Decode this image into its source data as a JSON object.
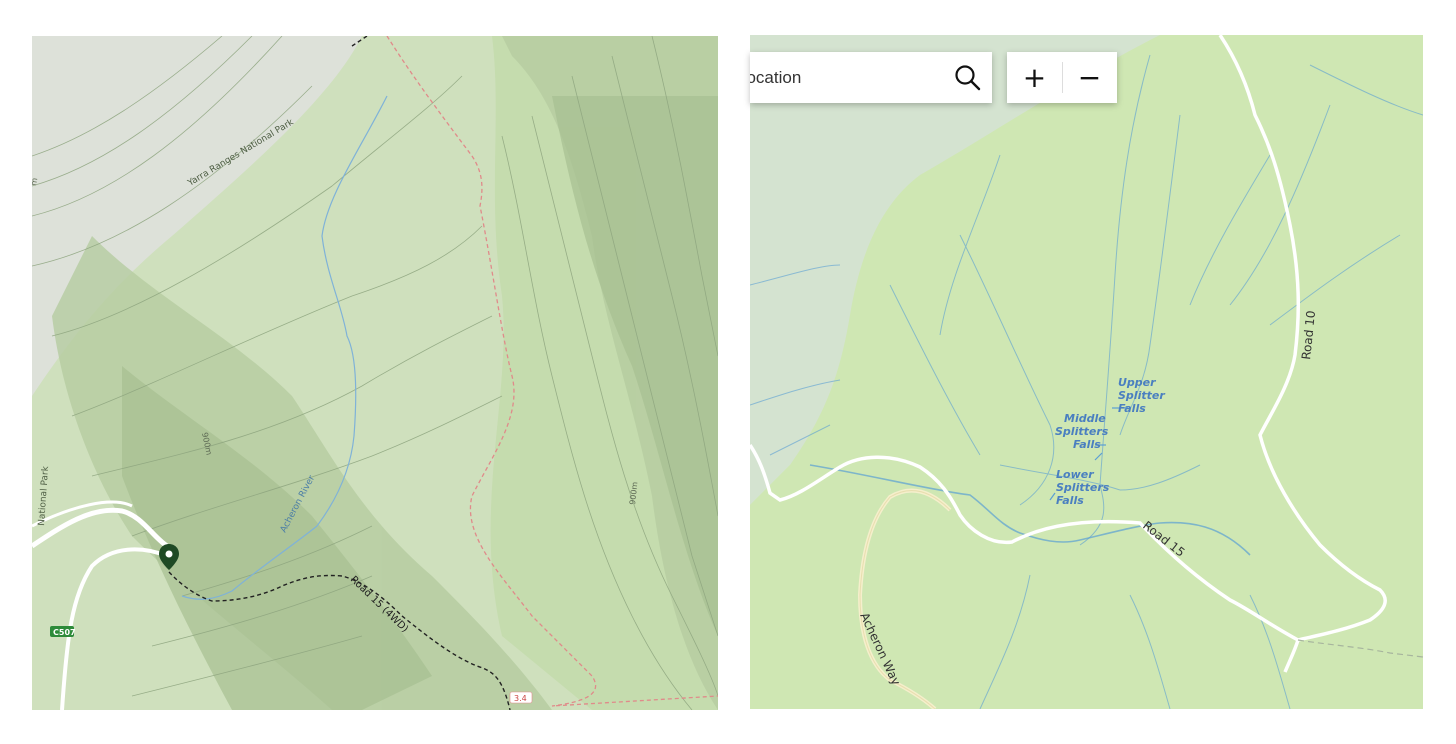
{
  "left_map": {
    "labels": {
      "park_name": "Yarra Ranges National Park",
      "park_edge": "National Park",
      "elev_a": "900m",
      "elev_b": "900m",
      "river": "Acheron River",
      "road": "Road 15 (4WD)",
      "route_badge": "C507",
      "road_num": "3.4",
      "edge_m": "m"
    },
    "colors": {
      "forest": "#cfe0bd",
      "park": "#c2dba8",
      "trail": "#222222",
      "boundary": "#e08a8a",
      "water": "#7fb2d8"
    }
  },
  "right_map": {
    "labels": {
      "upper_falls": [
        "Upper",
        "Splitter",
        "Falls"
      ],
      "middle_falls": [
        "Middle",
        "Splitters",
        "Falls"
      ],
      "lower_falls": [
        "Lower",
        "Splitters",
        "Falls"
      ],
      "road10": "Road 10",
      "road15": "Road 15",
      "acheron_way": "Acheron Way"
    },
    "colors": {
      "land": "#cfe7b3",
      "water": "#5a9fd4",
      "road": "#ffffff",
      "alpine": "#d5e2cf"
    }
  },
  "search": {
    "value": "Location"
  },
  "zoom": {
    "in_label": "+",
    "out_label": "−"
  }
}
